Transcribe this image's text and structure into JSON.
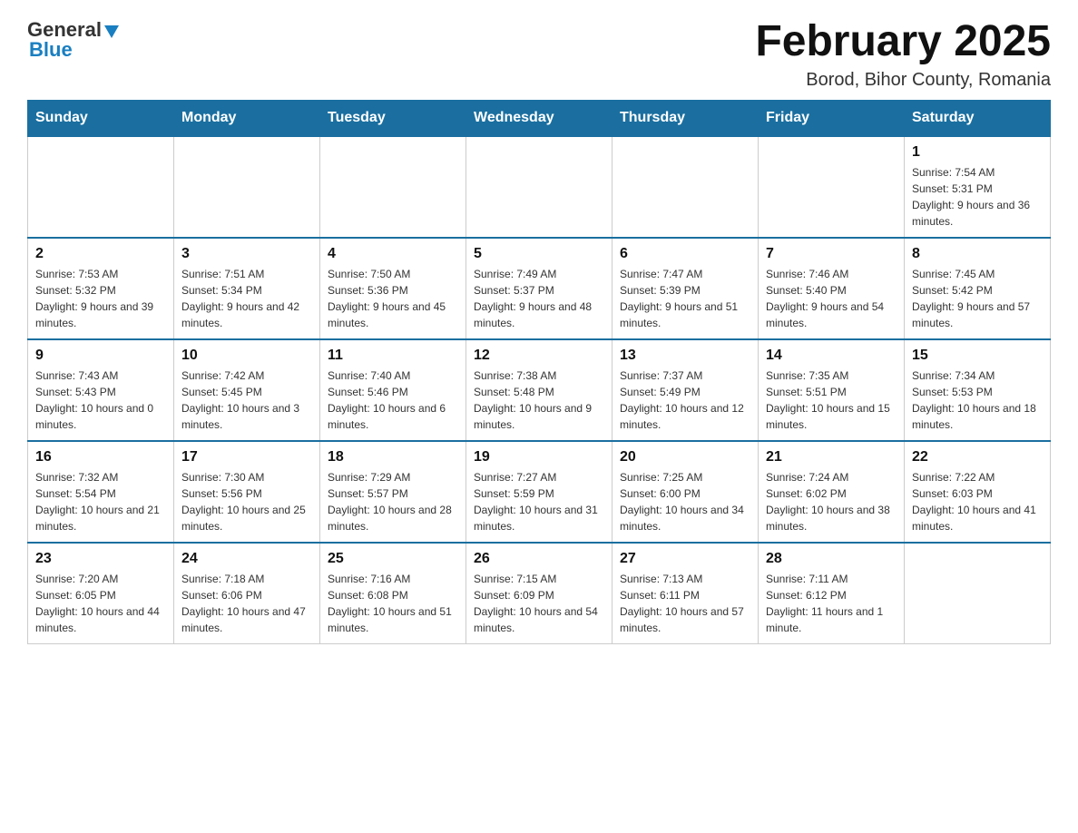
{
  "header": {
    "logo_general": "General",
    "logo_blue": "Blue",
    "month_title": "February 2025",
    "location": "Borod, Bihor County, Romania"
  },
  "days_of_week": [
    "Sunday",
    "Monday",
    "Tuesday",
    "Wednesday",
    "Thursday",
    "Friday",
    "Saturday"
  ],
  "weeks": [
    [
      {
        "day": "",
        "info": ""
      },
      {
        "day": "",
        "info": ""
      },
      {
        "day": "",
        "info": ""
      },
      {
        "day": "",
        "info": ""
      },
      {
        "day": "",
        "info": ""
      },
      {
        "day": "",
        "info": ""
      },
      {
        "day": "1",
        "info": "Sunrise: 7:54 AM\nSunset: 5:31 PM\nDaylight: 9 hours and 36 minutes."
      }
    ],
    [
      {
        "day": "2",
        "info": "Sunrise: 7:53 AM\nSunset: 5:32 PM\nDaylight: 9 hours and 39 minutes."
      },
      {
        "day": "3",
        "info": "Sunrise: 7:51 AM\nSunset: 5:34 PM\nDaylight: 9 hours and 42 minutes."
      },
      {
        "day": "4",
        "info": "Sunrise: 7:50 AM\nSunset: 5:36 PM\nDaylight: 9 hours and 45 minutes."
      },
      {
        "day": "5",
        "info": "Sunrise: 7:49 AM\nSunset: 5:37 PM\nDaylight: 9 hours and 48 minutes."
      },
      {
        "day": "6",
        "info": "Sunrise: 7:47 AM\nSunset: 5:39 PM\nDaylight: 9 hours and 51 minutes."
      },
      {
        "day": "7",
        "info": "Sunrise: 7:46 AM\nSunset: 5:40 PM\nDaylight: 9 hours and 54 minutes."
      },
      {
        "day": "8",
        "info": "Sunrise: 7:45 AM\nSunset: 5:42 PM\nDaylight: 9 hours and 57 minutes."
      }
    ],
    [
      {
        "day": "9",
        "info": "Sunrise: 7:43 AM\nSunset: 5:43 PM\nDaylight: 10 hours and 0 minutes."
      },
      {
        "day": "10",
        "info": "Sunrise: 7:42 AM\nSunset: 5:45 PM\nDaylight: 10 hours and 3 minutes."
      },
      {
        "day": "11",
        "info": "Sunrise: 7:40 AM\nSunset: 5:46 PM\nDaylight: 10 hours and 6 minutes."
      },
      {
        "day": "12",
        "info": "Sunrise: 7:38 AM\nSunset: 5:48 PM\nDaylight: 10 hours and 9 minutes."
      },
      {
        "day": "13",
        "info": "Sunrise: 7:37 AM\nSunset: 5:49 PM\nDaylight: 10 hours and 12 minutes."
      },
      {
        "day": "14",
        "info": "Sunrise: 7:35 AM\nSunset: 5:51 PM\nDaylight: 10 hours and 15 minutes."
      },
      {
        "day": "15",
        "info": "Sunrise: 7:34 AM\nSunset: 5:53 PM\nDaylight: 10 hours and 18 minutes."
      }
    ],
    [
      {
        "day": "16",
        "info": "Sunrise: 7:32 AM\nSunset: 5:54 PM\nDaylight: 10 hours and 21 minutes."
      },
      {
        "day": "17",
        "info": "Sunrise: 7:30 AM\nSunset: 5:56 PM\nDaylight: 10 hours and 25 minutes."
      },
      {
        "day": "18",
        "info": "Sunrise: 7:29 AM\nSunset: 5:57 PM\nDaylight: 10 hours and 28 minutes."
      },
      {
        "day": "19",
        "info": "Sunrise: 7:27 AM\nSunset: 5:59 PM\nDaylight: 10 hours and 31 minutes."
      },
      {
        "day": "20",
        "info": "Sunrise: 7:25 AM\nSunset: 6:00 PM\nDaylight: 10 hours and 34 minutes."
      },
      {
        "day": "21",
        "info": "Sunrise: 7:24 AM\nSunset: 6:02 PM\nDaylight: 10 hours and 38 minutes."
      },
      {
        "day": "22",
        "info": "Sunrise: 7:22 AM\nSunset: 6:03 PM\nDaylight: 10 hours and 41 minutes."
      }
    ],
    [
      {
        "day": "23",
        "info": "Sunrise: 7:20 AM\nSunset: 6:05 PM\nDaylight: 10 hours and 44 minutes."
      },
      {
        "day": "24",
        "info": "Sunrise: 7:18 AM\nSunset: 6:06 PM\nDaylight: 10 hours and 47 minutes."
      },
      {
        "day": "25",
        "info": "Sunrise: 7:16 AM\nSunset: 6:08 PM\nDaylight: 10 hours and 51 minutes."
      },
      {
        "day": "26",
        "info": "Sunrise: 7:15 AM\nSunset: 6:09 PM\nDaylight: 10 hours and 54 minutes."
      },
      {
        "day": "27",
        "info": "Sunrise: 7:13 AM\nSunset: 6:11 PM\nDaylight: 10 hours and 57 minutes."
      },
      {
        "day": "28",
        "info": "Sunrise: 7:11 AM\nSunset: 6:12 PM\nDaylight: 11 hours and 1 minute."
      },
      {
        "day": "",
        "info": ""
      }
    ]
  ]
}
